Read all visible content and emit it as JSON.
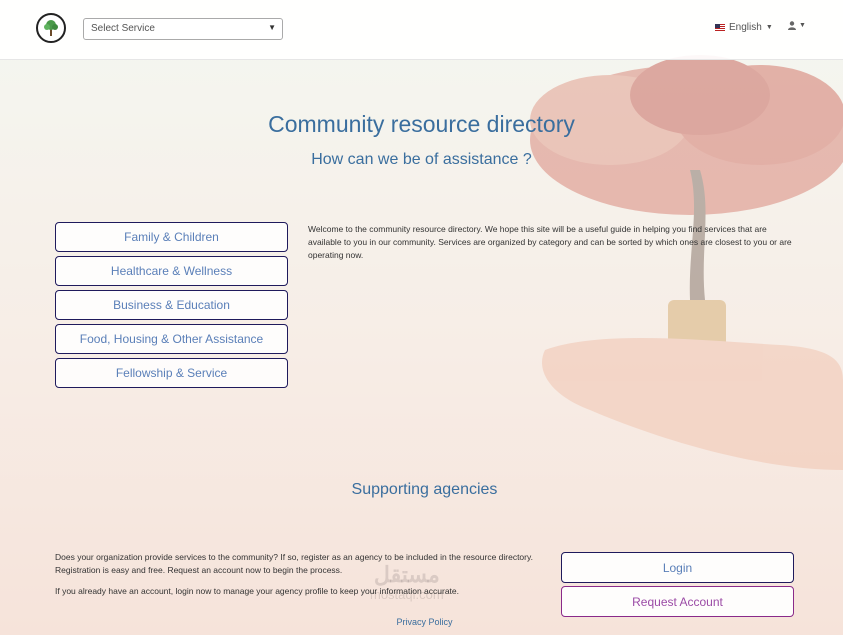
{
  "header": {
    "logo_icon": "tree-logo-icon",
    "select_service": {
      "placeholder": "Select Service"
    },
    "language": {
      "label": "English",
      "flag_icon": "us-flag-icon"
    },
    "user_menu_icon": "user-icon"
  },
  "main": {
    "title": "Community resource directory",
    "subtitle": "How can we be of assistance ?",
    "categories": [
      {
        "label": "Family & Children"
      },
      {
        "label": "Healthcare & Wellness"
      },
      {
        "label": "Business & Education"
      },
      {
        "label": "Food, Housing & Other Assistance"
      },
      {
        "label": "Fellowship & Service"
      }
    ],
    "welcome_text": "Welcome to the community resource directory. We hope this site will be a useful guide in helping you find services that are available to you in our community. Services are organized by category and can be sorted by which ones are closest to you or are operating now."
  },
  "agencies": {
    "title": "Supporting agencies",
    "paragraph1": "Does your organization provide services to the community? If so, register as an agency to be included in the resource directory. Registration is easy and free. Request an account now to begin the process.",
    "paragraph2": "If you already have an account, login now to manage your agency profile to keep your information accurate.",
    "login_label": "Login",
    "request_label": "Request Account"
  },
  "footer": {
    "privacy_label": "Privacy Policy"
  },
  "watermark": {
    "arabic": "مستقل",
    "latin": "mostaql.com"
  },
  "colors": {
    "heading": "#3a6e9e",
    "button_text": "#5a7fb8",
    "button_border": "#1f1a5c",
    "request_border": "#8a2a8a"
  }
}
